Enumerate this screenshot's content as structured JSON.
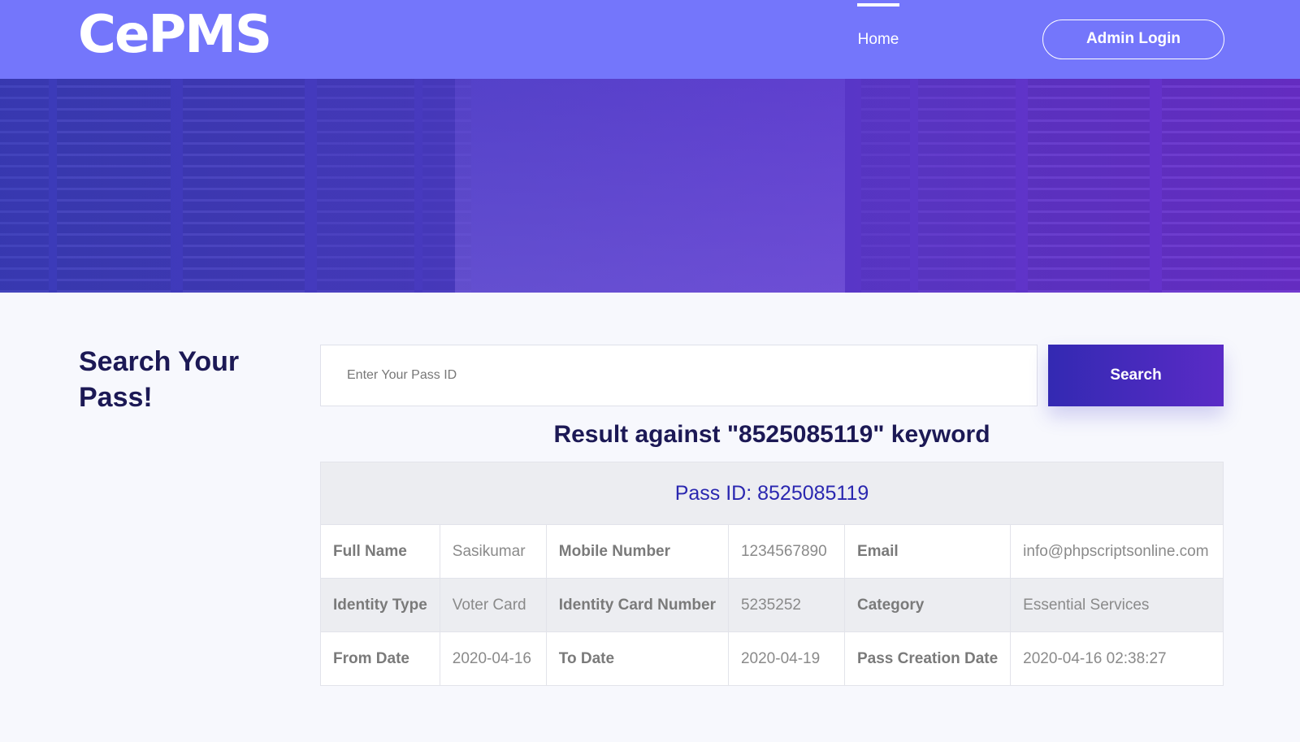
{
  "header": {
    "logo": "CePMS",
    "nav_home": "Home",
    "admin_login": "Admin Login"
  },
  "search": {
    "heading": "Search Your Pass!",
    "placeholder": "Enter Your Pass ID",
    "button": "Search"
  },
  "result": {
    "title": "Result against \"8525085119\" keyword",
    "pass_id": "Pass ID: 8525085119",
    "rows": [
      [
        {
          "label": "Full Name",
          "value": "Sasikumar"
        },
        {
          "label": "Mobile Number",
          "value": "1234567890"
        },
        {
          "label": "Email",
          "value": "info@phpscriptsonline.com"
        }
      ],
      [
        {
          "label": "Identity Type",
          "value": "Voter Card"
        },
        {
          "label": "Identity Card Number",
          "value": "5235252"
        },
        {
          "label": "Category",
          "value": "Essential Services"
        }
      ],
      [
        {
          "label": "From Date",
          "value": "2020-04-16"
        },
        {
          "label": "To Date",
          "value": "2020-04-19"
        },
        {
          "label": "Pass Creation Date",
          "value": "2020-04-16 02:38:27"
        }
      ]
    ]
  },
  "colors": {
    "navbar": "#7476fb",
    "heading": "#1c1955",
    "accent": "#3329b2"
  }
}
